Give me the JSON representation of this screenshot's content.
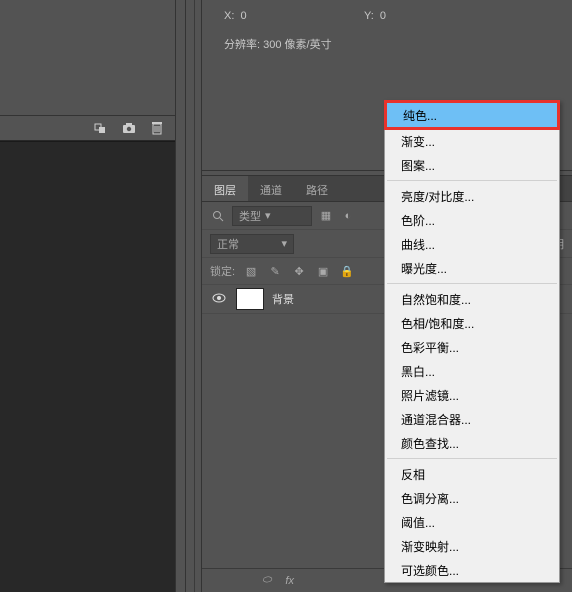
{
  "info": {
    "x_label": "X:",
    "x_value": "0",
    "y_label": "Y:",
    "y_value": "0",
    "resolution": "分辨率: 300 像素/英寸"
  },
  "tabs": {
    "layers": "图层",
    "channels": "通道",
    "paths": "路径"
  },
  "layer_controls": {
    "kind_label": "类型",
    "blend_mode": "正常",
    "opacity_label": "不透明",
    "lock_label": "锁定:"
  },
  "layer": {
    "name": "背景"
  },
  "bottom_icons": {
    "link": "⬭",
    "fx": "fx"
  },
  "menu": {
    "solid_color": "纯色...",
    "gradient": "渐变...",
    "pattern": "图案...",
    "brightness": "亮度/对比度...",
    "levels": "色阶...",
    "curves": "曲线...",
    "exposure": "曝光度...",
    "vibrance": "自然饱和度...",
    "hue": "色相/饱和度...",
    "color_balance": "色彩平衡...",
    "bw": "黑白...",
    "photo_filter": "照片滤镜...",
    "channel_mixer": "通道混合器...",
    "color_lookup": "颜色查找...",
    "invert": "反相",
    "posterize": "色调分离...",
    "threshold": "阈值...",
    "gradient_map": "渐变映射...",
    "selective": "可选颜色..."
  }
}
